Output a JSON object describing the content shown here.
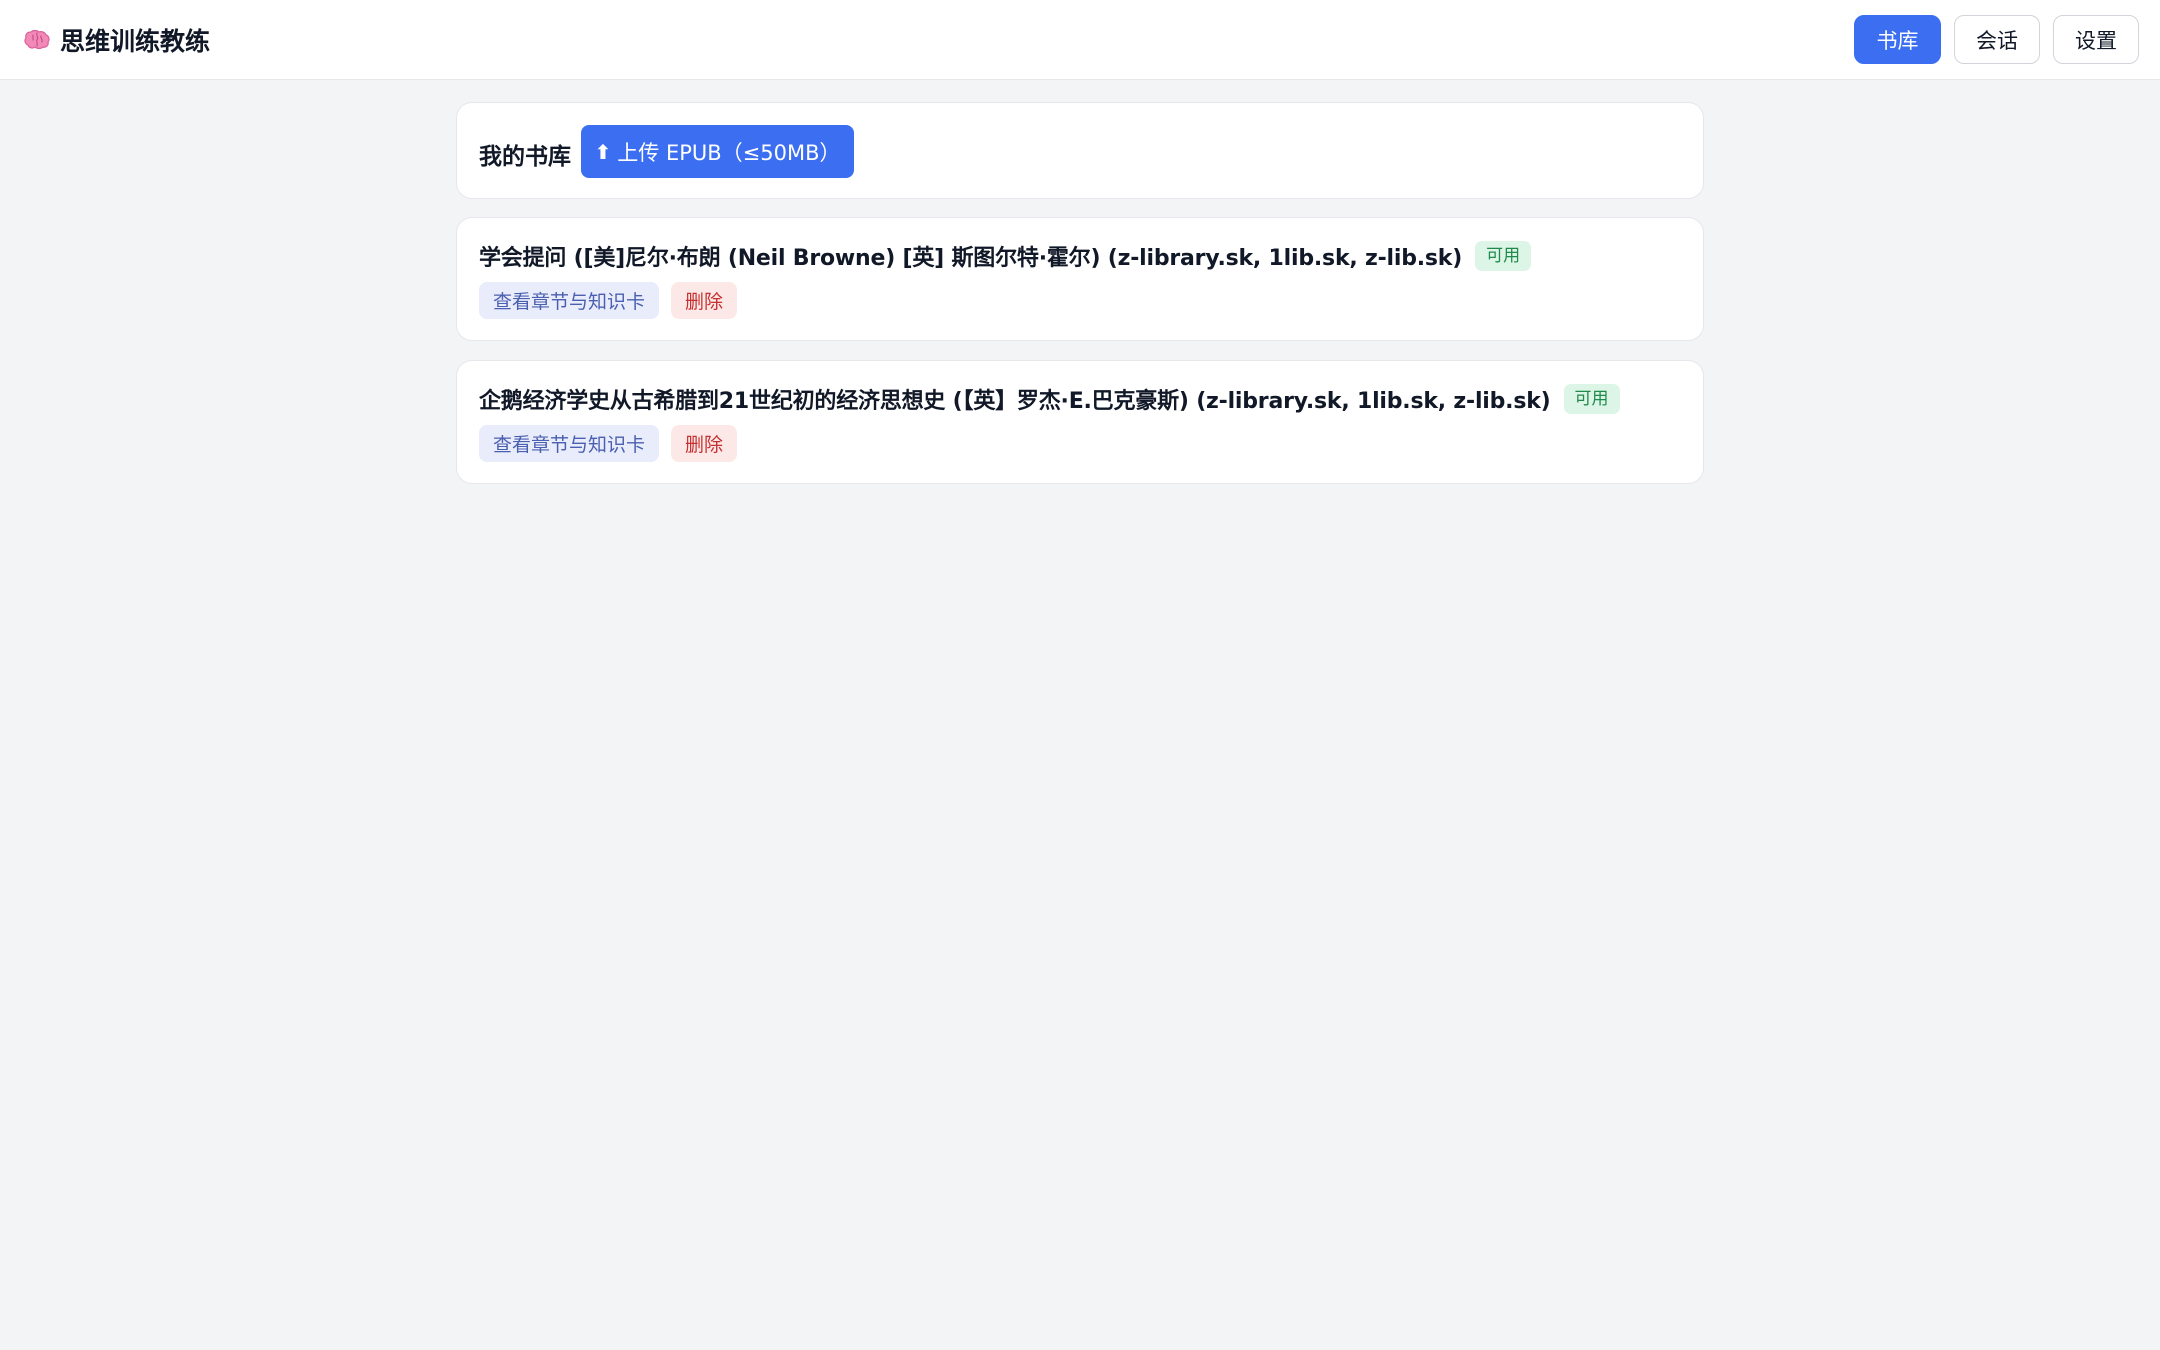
{
  "app": {
    "title": "思维训练教练",
    "icon": "brain-icon"
  },
  "nav": {
    "library_label": "书库",
    "chat_label": "会话",
    "settings_label": "设置",
    "active": "library_label"
  },
  "library": {
    "title": "我的书库",
    "upload_label": "上传 EPUB（≤50MB）",
    "upload_icon": "upload-arrow-icon"
  },
  "books": [
    {
      "title": "学会提问 ([美]尼尔·布朗 (Neil Browne) [英] 斯图尔特·霍尔) (z-library.sk, 1lib.sk, z-lib.sk)",
      "status": "可用",
      "view_label": "查看章节与知识卡",
      "delete_label": "删除"
    },
    {
      "title": "企鹅经济学史从古希腊到21世纪初的经济思想史 (【英】罗杰·E.巴克豪斯) (z-library.sk, 1lib.sk, z-lib.sk)",
      "status": "可用",
      "view_label": "查看章节与知识卡",
      "delete_label": "删除"
    }
  ],
  "colors": {
    "accent": "#3b6ef0",
    "background": "#f3f4f6",
    "status_bg": "#dcf5e7",
    "status_text": "#1f8a4c",
    "delete_bg": "#fde8e8",
    "delete_text": "#c53030"
  }
}
